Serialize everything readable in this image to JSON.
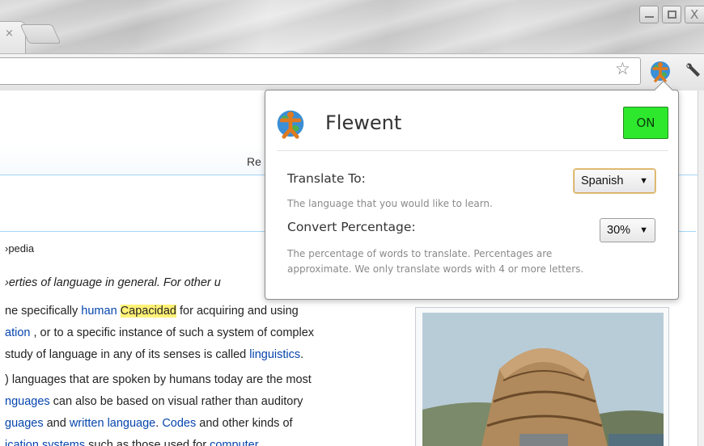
{
  "window": {
    "tab_close_glyph": "×",
    "close_glyph": "X",
    "controls": [
      "minimize-icon",
      "maximize-icon",
      "close-icon"
    ]
  },
  "toolbar": {
    "icons": [
      "star-icon",
      "flewent-extension-icon",
      "wrench-icon"
    ]
  },
  "page": {
    "read_tab": "Re",
    "from_wiki": "›pedia",
    "hatnote": "›erties of language in general. For other u",
    "paragraphs": [
      {
        "runs": [
          {
            "t": "ne specifically ",
            "k": "text"
          },
          {
            "t": "human",
            "k": "link"
          },
          {
            "t": " ",
            "k": "text"
          },
          {
            "t": "Capacidad",
            "k": "highlight"
          },
          {
            "t": " for acquiring and using",
            "k": "text"
          }
        ]
      },
      {
        "runs": [
          {
            "t": "ation",
            "k": "link"
          },
          {
            "t": " , or to a specific instance of such a system of complex",
            "k": "text"
          }
        ]
      },
      {
        "runs": [
          {
            "t": "study of language in any of its senses is called ",
            "k": "text"
          },
          {
            "t": "linguistics",
            "k": "link"
          },
          {
            "t": ".",
            "k": "text"
          }
        ]
      },
      {
        "runs": [
          {
            "t": ") languages that are spoken by humans today are the most",
            "k": "text"
          }
        ]
      },
      {
        "runs": [
          {
            "t": "nguages",
            "k": "link"
          },
          {
            "t": " can also be based on visual rather than auditory",
            "k": "text"
          }
        ]
      },
      {
        "runs": [
          {
            "t": "guages",
            "k": "link"
          },
          {
            "t": " and ",
            "k": "text"
          },
          {
            "t": "written language",
            "k": "link"
          },
          {
            "t": ". ",
            "k": "text"
          },
          {
            "t": "Codes",
            "k": "link"
          },
          {
            "t": " and other kinds of",
            "k": "text"
          }
        ]
      },
      {
        "runs": [
          {
            "t": "ication systems",
            "k": "link"
          },
          {
            "t": " such as those used for ",
            "k": "text"
          },
          {
            "t": "computer",
            "k": "link"
          }
        ]
      }
    ],
    "link_color": "#0645ad",
    "highlight_color": "#fff176"
  },
  "popup": {
    "title": "Flewent",
    "toggle_label": "ON",
    "toggle_color": "#2ee82e",
    "translate_label": "Translate To:",
    "translate_desc": "The language that you would like to learn.",
    "translate_value": "Spanish",
    "convert_label": "Convert Percentage:",
    "convert_desc_1": "The percentage of words to translate. Percentages are",
    "convert_desc_2": "approximate. We only translate words with 4 or more letters.",
    "convert_value": "30%",
    "select_arrow": "▼"
  }
}
